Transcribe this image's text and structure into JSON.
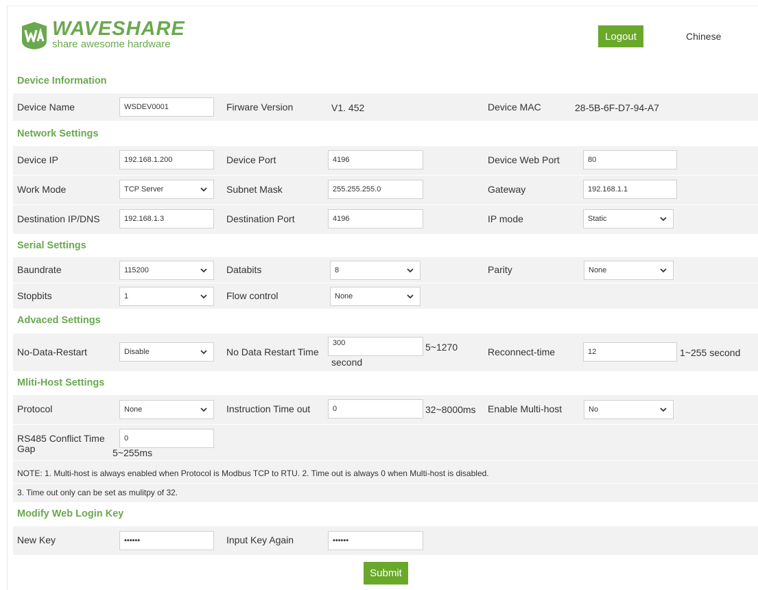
{
  "header": {
    "logo_name": "WAVESHARE",
    "logo_tagline": "share awesome hardware",
    "logout_label": "Logout",
    "language_label": "Chinese"
  },
  "colors": {
    "accent": "#6aa82c",
    "band": "#f2f2f2"
  },
  "device_info": {
    "title": "Device Information",
    "device_name_label": "Device Name",
    "device_name_value": "WSDEV0001",
    "firmware_label": "Firware Version",
    "firmware_value": "V1. 452",
    "mac_label": "Device MAC",
    "mac_value": "28-5B-6F-D7-94-A7"
  },
  "network": {
    "title": "Network Settings",
    "device_ip_label": "Device IP",
    "device_ip_value": "192.168.1.200",
    "device_port_label": "Device Port",
    "device_port_value": "4196",
    "web_port_label": "Device Web Port",
    "web_port_value": "80",
    "work_mode_label": "Work Mode",
    "work_mode_value": "TCP Server",
    "subnet_label": "Subnet Mask",
    "subnet_value": "255.255.255.0",
    "gateway_label": "Gateway",
    "gateway_value": "192.168.1.1",
    "dest_ip_label": "Destination IP/DNS",
    "dest_ip_value": "192.168.1.3",
    "dest_port_label": "Destination Port",
    "dest_port_value": "4196",
    "ip_mode_label": "IP mode",
    "ip_mode_value": "Static"
  },
  "serial": {
    "title": "Serial Settings",
    "baud_label": "Baundrate",
    "baud_value": "115200",
    "databits_label": "Databits",
    "databits_value": "8",
    "parity_label": "Parity",
    "parity_value": "None",
    "stopbits_label": "Stopbits",
    "stopbits_value": "1",
    "flow_label": "Flow control",
    "flow_value": "None"
  },
  "advanced": {
    "title": "Advaced Settings",
    "ndr_label": "No-Data-Restart",
    "ndr_value": "Disable",
    "ndr_time_label": "No Data Restart Time",
    "ndr_time_value": "300",
    "ndr_time_range": "5~1270",
    "ndr_time_unit": "second",
    "reconnect_label": "Reconnect-time",
    "reconnect_value": "12",
    "reconnect_range": "1~255 second"
  },
  "multihost": {
    "title": "Mliti-Host Settings",
    "protocol_label": "Protocol",
    "protocol_value": "None",
    "timeout_label": "Instruction Time out",
    "timeout_value": "0",
    "timeout_range": "32~8000ms",
    "enable_label": "Enable Multi-host",
    "enable_value": "No",
    "conflict_label_1": "RS485 Conflict Time",
    "conflict_label_2": "Gap",
    "conflict_value": "0",
    "conflict_range": "5~255ms",
    "note_1": "NOTE: 1. Multi-host is always enabled when Protocol is Modbus TCP to RTU. 2. Time out is always 0 when Multi-host is disabled.",
    "note_2": "3. Time out only can be set as mulitpy of 32."
  },
  "login_key": {
    "title": "Modify Web Login Key",
    "new_key_label": "New Key",
    "new_key_value": "••••••",
    "again_label": "Input Key Again",
    "again_value": "••••••"
  },
  "submit_label": "Submit"
}
